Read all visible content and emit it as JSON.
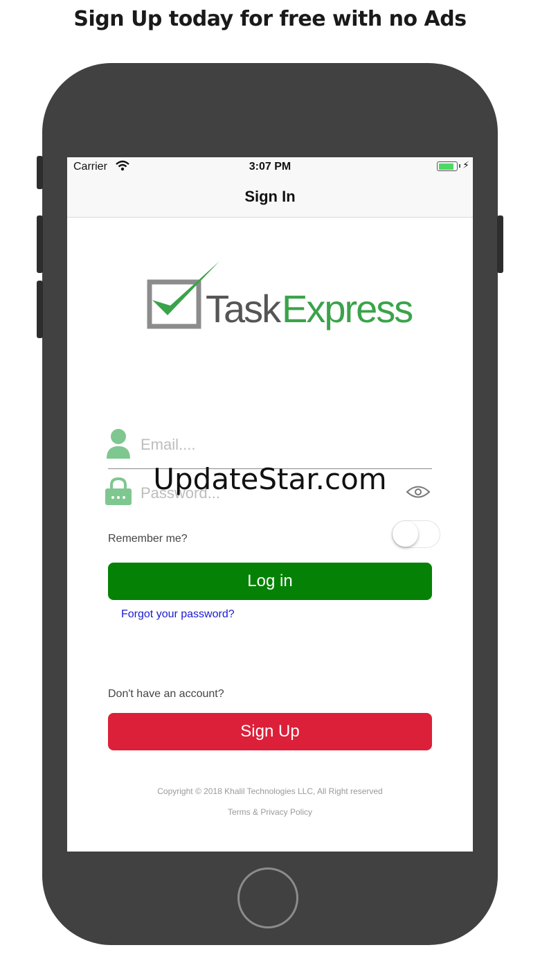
{
  "banner": {
    "text": "Sign Up today for free with no Ads"
  },
  "statusbar": {
    "carrier": "Carrier",
    "time": "3:07 PM",
    "battery_level": 0.85
  },
  "navbar": {
    "title": "Sign In"
  },
  "logo": {
    "word1": "Task",
    "word2": "Express",
    "colors": {
      "check": "#3aa349",
      "box": "#8c8c8c",
      "task": "#555555",
      "express": "#3aa349"
    }
  },
  "form": {
    "email_placeholder": "Email....",
    "password_placeholder": "Password...",
    "remember_label": "Remember me?",
    "remember_on": false,
    "login_label": "Log in",
    "forgot_label": "Forgot your password?",
    "no_account_label": "Don't have an account?",
    "signup_label": "Sign Up"
  },
  "footer": {
    "copyright": "Copyright © 2018 Khalil Technologies LLC, All Right reserved",
    "terms": "Terms & Privacy Policy"
  },
  "watermark": {
    "text": "UpdateStar.com"
  },
  "icons": [
    "wifi-icon",
    "battery-icon",
    "user-icon",
    "lock-icon",
    "eye-icon",
    "home-button"
  ],
  "colors": {
    "login": "#058205",
    "signup": "#dc2039",
    "link": "#1a1ad0",
    "field_icon": "#7fc790"
  }
}
